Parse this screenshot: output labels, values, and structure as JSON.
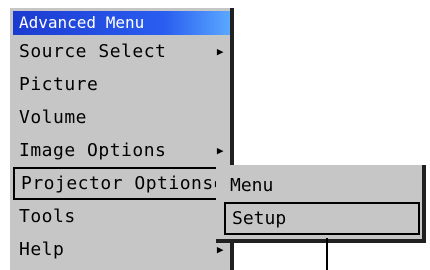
{
  "menu": {
    "title": "Advanced Menu",
    "items": [
      {
        "label": "Source Select",
        "arrow": "▶"
      },
      {
        "label": "Picture",
        "arrow": ""
      },
      {
        "label": "Volume",
        "arrow": ""
      },
      {
        "label": "Image Options",
        "arrow": "▶"
      },
      {
        "label": "Projector Options",
        "arrow": "▶"
      },
      {
        "label": "Tools",
        "arrow": "▶"
      },
      {
        "label": "Help",
        "arrow": "▶"
      }
    ]
  },
  "submenu": {
    "items": [
      {
        "label": "Menu"
      },
      {
        "label": "Setup"
      }
    ]
  },
  "colors": {
    "menu_bg": "#c6c6c6",
    "title_bg": "#2a5ef0",
    "title_text": "#ffffff"
  }
}
